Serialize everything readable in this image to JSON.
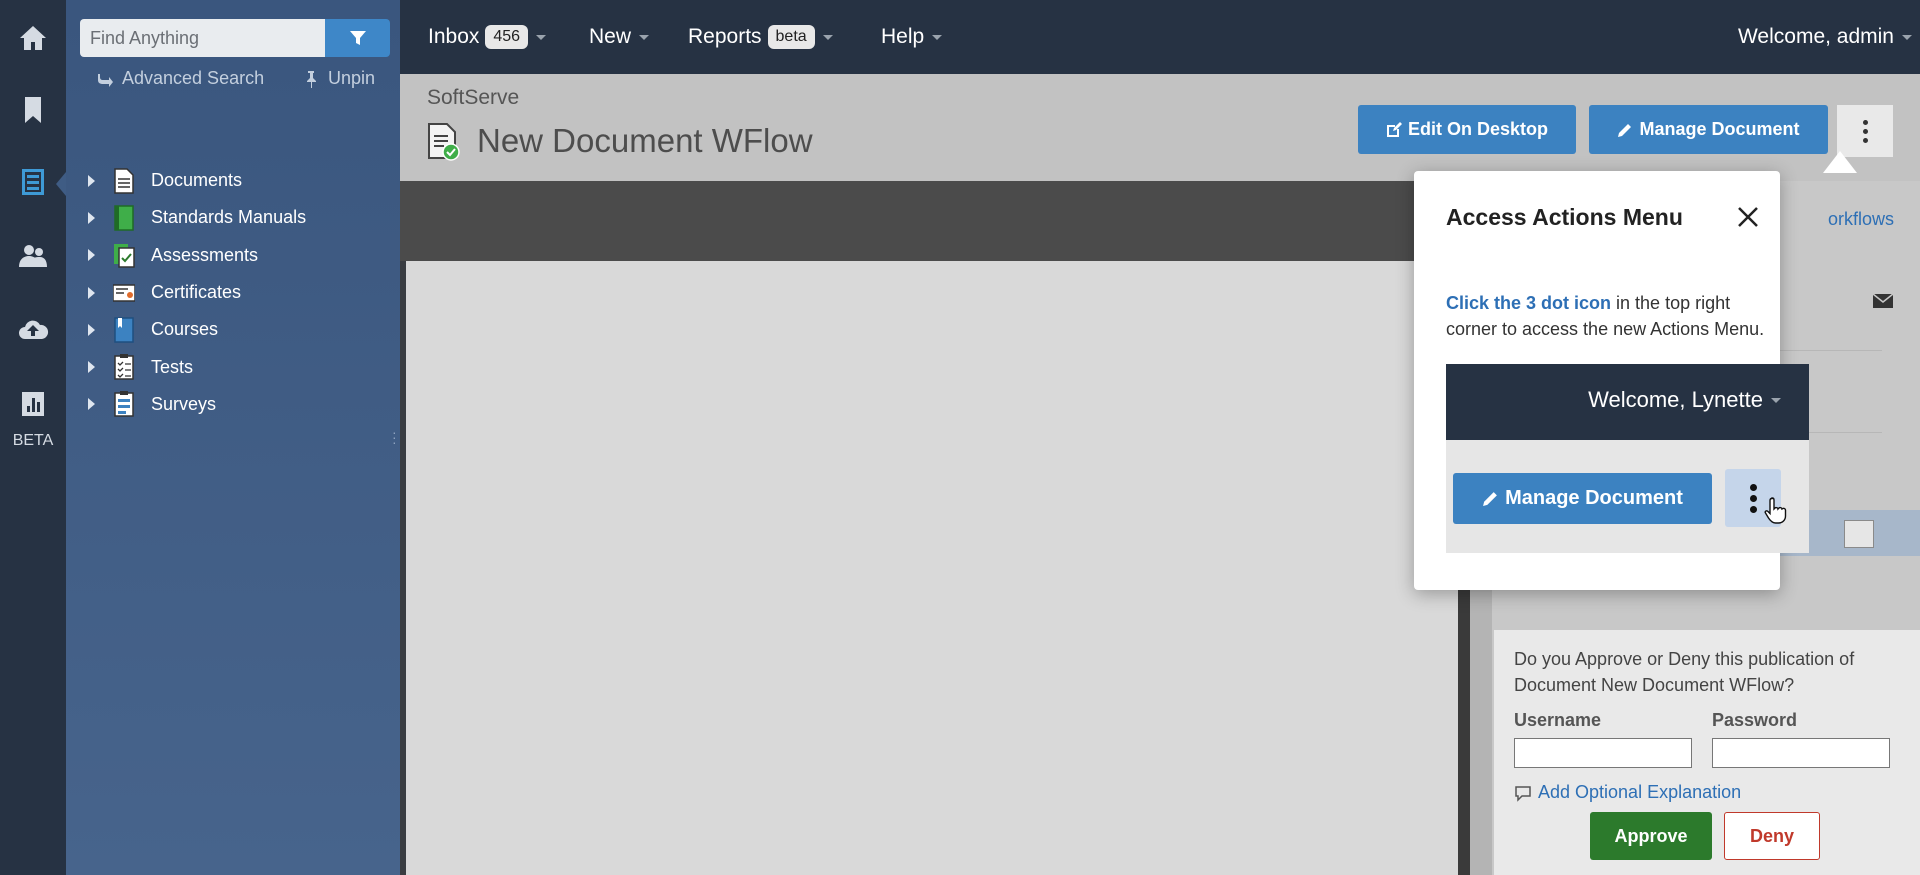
{
  "rail": {
    "beta_label": "BETA",
    "icons": [
      "home-icon",
      "bookmark-icon",
      "documents-icon",
      "users-icon",
      "cloud-upload-icon",
      "bar-chart-icon"
    ]
  },
  "sidebar": {
    "search_placeholder": "Find Anything",
    "advanced_search": "Advanced Search",
    "unpin": "Unpin",
    "tree": [
      {
        "label": "Documents",
        "icon": "document-icon"
      },
      {
        "label": "Standards Manuals",
        "icon": "manual-icon"
      },
      {
        "label": "Assessments",
        "icon": "assessment-icon"
      },
      {
        "label": "Certificates",
        "icon": "certificate-icon"
      },
      {
        "label": "Courses",
        "icon": "course-icon"
      },
      {
        "label": "Tests",
        "icon": "test-icon"
      },
      {
        "label": "Surveys",
        "icon": "survey-icon"
      }
    ]
  },
  "topnav": {
    "inbox": "Inbox",
    "inbox_count": "456",
    "new": "New",
    "reports": "Reports",
    "reports_badge": "beta",
    "help": "Help",
    "welcome": "Welcome, admin"
  },
  "header": {
    "breadcrumb": "SoftServe",
    "title": "New Document WFlow",
    "edit_desktop": "Edit On Desktop",
    "manage_document": "Manage Document"
  },
  "right_panel": {
    "workflows_link": "orkflows",
    "approve_question": "Do you Approve or Deny this publication of Document New Document WFlow?",
    "username_label": "Username",
    "password_label": "Password",
    "optional_explanation": "Add Optional Explanation",
    "approve": "Approve",
    "deny": "Deny"
  },
  "popover": {
    "title": "Access Actions Menu",
    "highlight": "Click the 3 dot icon",
    "body": " in the top right corner to access the new Actions Menu.",
    "demo_welcome": "Welcome, Lynette",
    "demo_manage": "Manage Document"
  },
  "colors": {
    "nav_bg": "#263243",
    "sidebar_bg": "#3a567e",
    "accent_blue": "#3c82c1",
    "approve_green": "#2c7a2c",
    "deny_red": "#c0392b"
  }
}
